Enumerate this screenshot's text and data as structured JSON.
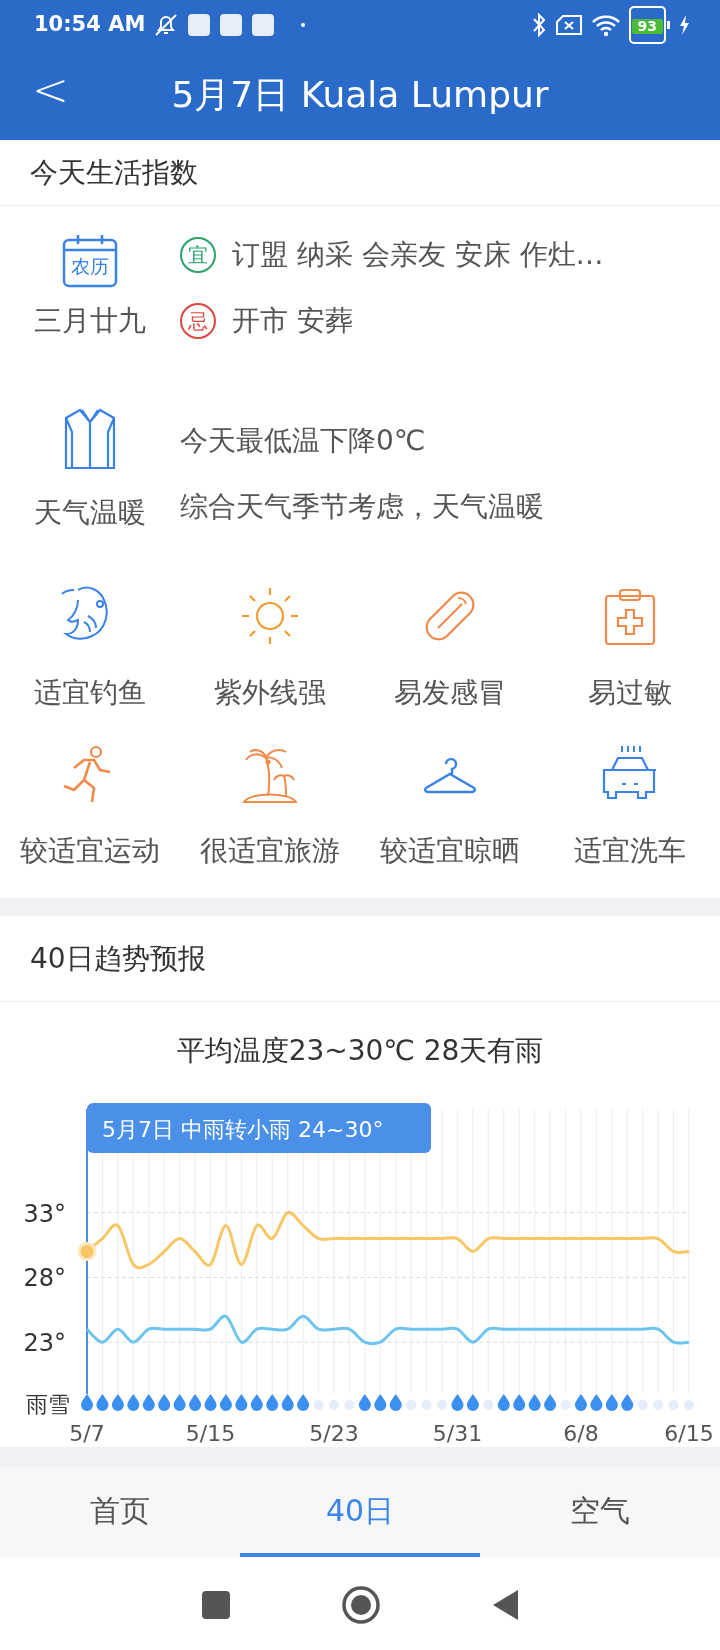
{
  "status_bar": {
    "time": "10:54 AM",
    "battery": "93"
  },
  "header": {
    "back": "<",
    "title": "5月7日 Kuala Lumpur"
  },
  "life_index": {
    "title": "今天生活指数",
    "almanac": {
      "calendar_badge": "农历",
      "lunar_date": "三月廿九",
      "good_mark": "宜",
      "good": "订盟 纳采 会亲友 安床 作灶…",
      "bad_mark": "忌",
      "bad": "开市 安葬"
    },
    "clothing": {
      "label": "天气温暖",
      "lines": [
        "今天最低温下降0℃",
        "综合天气季节考虑，天气温暖"
      ]
    },
    "items": [
      {
        "label": "适宜钓鱼",
        "color": "#3b82e6"
      },
      {
        "label": "紫外线强",
        "color": "#f29a2e"
      },
      {
        "label": "易发感冒",
        "color": "#f08a4b"
      },
      {
        "label": "易过敏",
        "color": "#f08a4b"
      },
      {
        "label": "较适宜运动",
        "color": "#f08a4b"
      },
      {
        "label": "很适宜旅游",
        "color": "#f08a4b"
      },
      {
        "label": "较适宜晾晒",
        "color": "#3b82e6"
      },
      {
        "label": "适宜洗车",
        "color": "#3b82e6"
      }
    ]
  },
  "forecast": {
    "title": "40日趋势预报",
    "summary": "平均温度23~30℃ 28天有雨",
    "tooltip": "5月7日 中雨转小雨 24~30°",
    "rain_label": "雨雪",
    "rain": [
      true,
      true,
      true,
      true,
      true,
      true,
      true,
      true,
      true,
      true,
      true,
      true,
      true,
      true,
      true,
      false,
      false,
      false,
      true,
      true,
      true,
      false,
      false,
      false,
      true,
      true,
      false,
      true,
      true,
      true,
      true,
      false,
      true,
      true,
      true,
      true,
      false,
      false,
      false,
      false
    ],
    "chart_data": {
      "type": "line",
      "categories": [
        "5/7",
        null,
        null,
        null,
        null,
        null,
        null,
        null,
        "5/15",
        null,
        null,
        null,
        null,
        null,
        null,
        null,
        "5/23",
        null,
        null,
        null,
        null,
        null,
        null,
        null,
        "5/31",
        null,
        null,
        null,
        null,
        null,
        null,
        null,
        "6/8",
        null,
        null,
        null,
        null,
        null,
        null,
        "6/15"
      ],
      "ylim": [
        19,
        41
      ],
      "grid": true,
      "yticks": [
        {
          "value": 33,
          "label": "33°"
        },
        {
          "value": 28,
          "label": "28°"
        },
        {
          "value": 23,
          "label": "23°"
        }
      ],
      "series": [
        {
          "color": "#f7c766",
          "values": [
            30,
            31,
            32,
            29,
            29,
            30,
            31,
            30,
            29,
            32,
            29,
            32,
            31,
            33,
            32,
            31,
            31,
            31,
            31,
            31,
            31,
            31,
            31,
            31,
            31,
            30,
            31,
            31,
            31,
            31,
            31,
            31,
            31,
            31,
            31,
            31,
            31,
            31,
            30,
            30
          ]
        },
        {
          "color": "#6cc4ef",
          "values": [
            24,
            23,
            24,
            23,
            24,
            24,
            24,
            24,
            24,
            25,
            23,
            24,
            24,
            24,
            25,
            24,
            24,
            24,
            23,
            23,
            24,
            24,
            24,
            24,
            24,
            23,
            24,
            24,
            24,
            24,
            24,
            24,
            24,
            24,
            24,
            24,
            24,
            24,
            23,
            23
          ]
        }
      ]
    }
  },
  "tabs": [
    {
      "label": "首页",
      "selected": false
    },
    {
      "label": "40日",
      "selected": true
    },
    {
      "label": "空气",
      "selected": false
    }
  ]
}
